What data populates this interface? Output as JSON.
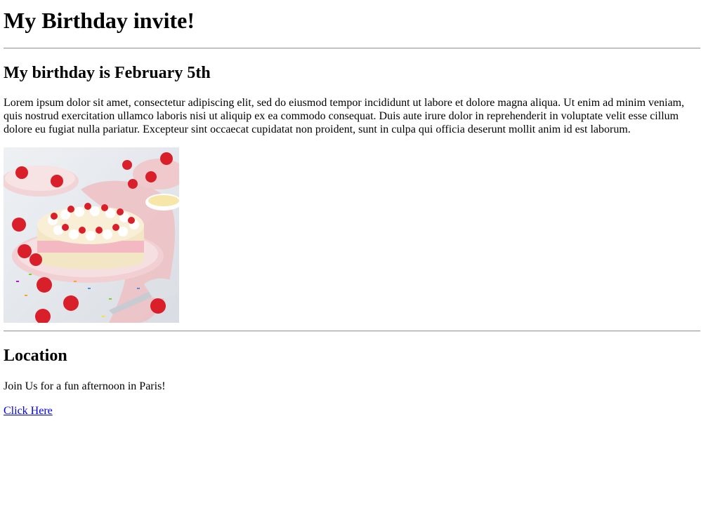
{
  "page": {
    "title": "My Birthday invite!",
    "birthday_heading": "My birthday is February 5th",
    "body_text": "Lorem ipsum dolor sit amet, consectetur adipiscing elit, sed do eiusmod tempor incididunt ut labore et dolore magna aliqua. Ut enim ad minim veniam, quis nostrud exercitation ullamco laboris nisi ut aliquip ex ea commodo consequat. Duis aute irure dolor in reprehenderit in voluptate velit esse cillum dolore eu fugiat nulla pariatur. Excepteur sint occaecat cupidatat non proident, sunt in culpa qui officia deserunt mollit anim id est laborum.",
    "image": {
      "icon": "birthday-cake-photo"
    },
    "location_heading": "Location",
    "location_text": "Join Us for a fun afternoon in Paris!",
    "link_text": "Click Here",
    "colors": {
      "link": "#0000ee",
      "cake_frosting": "#f3b8c2",
      "strawberry": "#d81f2a"
    }
  }
}
